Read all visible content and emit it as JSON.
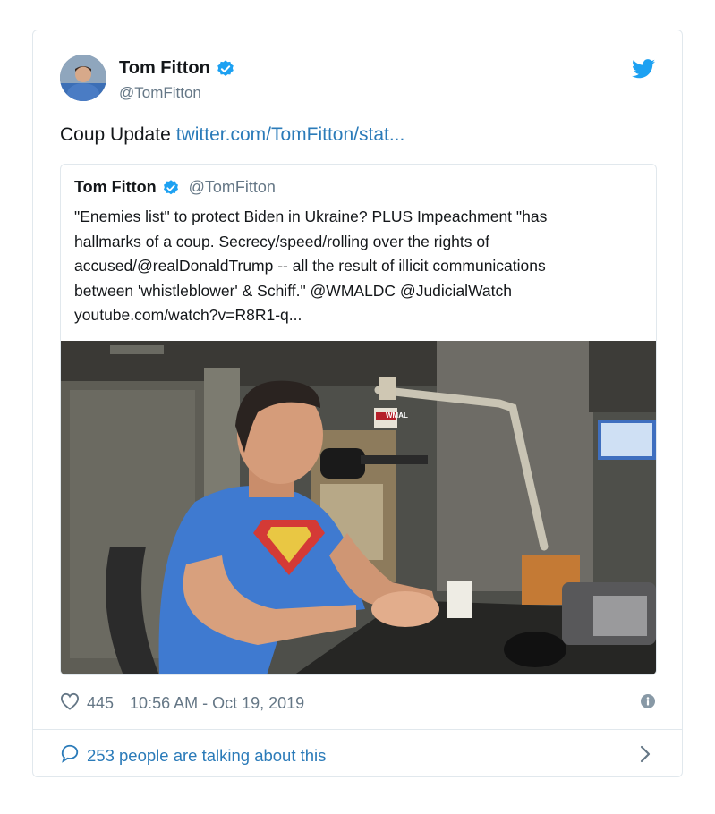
{
  "author": {
    "name": "Tom Fitton",
    "handle": "@TomFitton"
  },
  "tweet": {
    "text": "Coup Update",
    "link": "twitter.com/TomFitton/stat..."
  },
  "quoted": {
    "name": "Tom Fitton",
    "handle": "@TomFitton",
    "lines": [
      "\"Enemies list\" to protect Biden in Ukraine?  PLUS Impeachment \"has",
      "hallmarks of a coup. Secrecy/speed/rolling over the rights of",
      "accused/@realDonaldTrump -- all the result of illicit communications",
      "between 'whistleblower' & Schiff.\" @WMALDC @JudicialWatch",
      "youtube.com/watch?v=R8R1-q..."
    ],
    "media_sign": "WMAL"
  },
  "footer": {
    "likes": "445",
    "timestamp": "10:56 AM - Oct 19, 2019",
    "talking": "253 people are talking about this"
  },
  "colors": {
    "link": "#2b7bb9",
    "muted": "#657786",
    "border": "#e1e8ed",
    "twitter_blue": "#1da1f2"
  },
  "icons": [
    "verified-badge-icon",
    "twitter-bird-icon",
    "heart-icon",
    "info-icon",
    "comment-bubble-icon",
    "chevron-right-icon"
  ]
}
